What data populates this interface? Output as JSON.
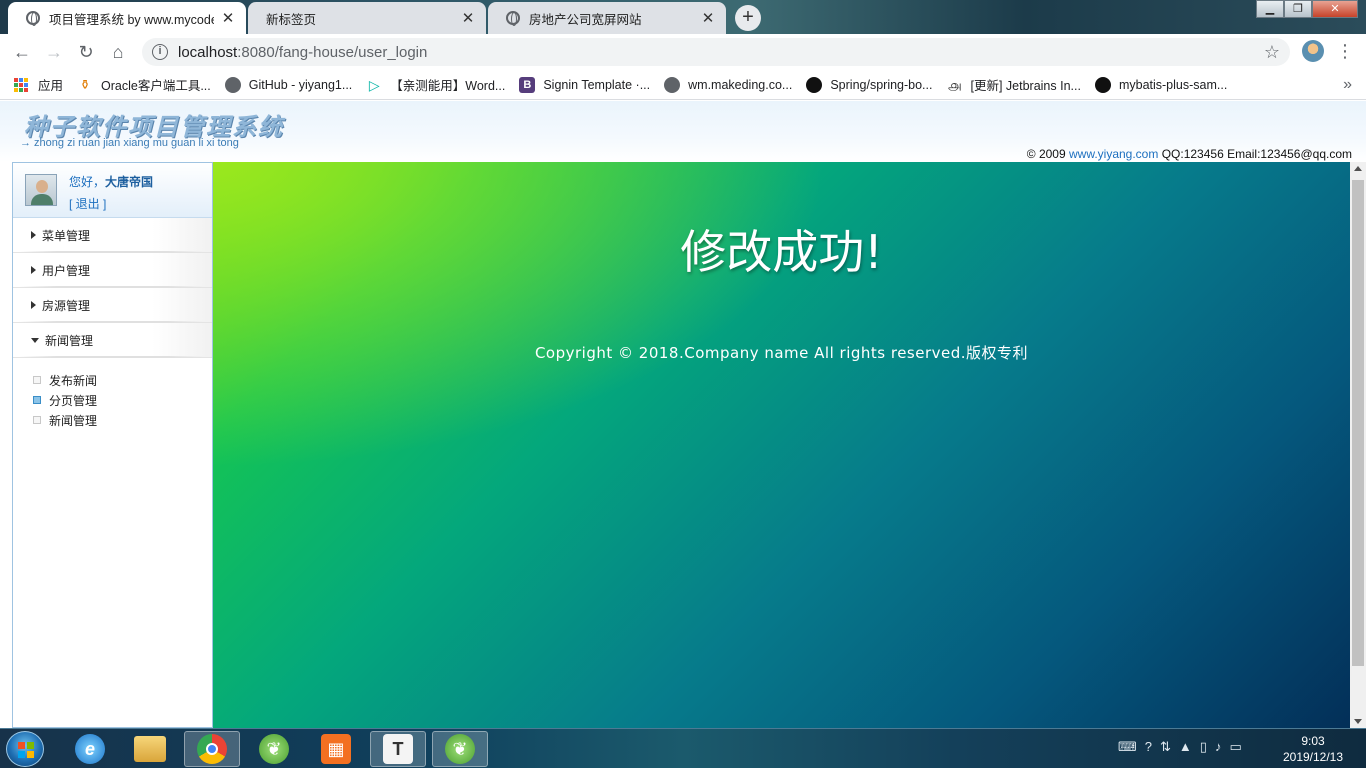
{
  "browser": {
    "tabs": [
      {
        "title": "项目管理系统 by www.mycodes",
        "active": true
      },
      {
        "title": "新标签页",
        "active": false
      },
      {
        "title": "房地产公司宽屏网站",
        "active": false
      }
    ],
    "new_tab": "+",
    "url_host": "localhost",
    "url_path": ":8080/fang-house/user_login",
    "bookmarks": [
      {
        "label": "应用",
        "icon": "apps-icon"
      },
      {
        "label": "Oracle客户端工具...",
        "icon": "oracle-icon"
      },
      {
        "label": "GitHub - yiyang1...",
        "icon": "globe-icon"
      },
      {
        "label": "【亲测能用】Word...",
        "icon": "play-icon"
      },
      {
        "label": "Signin Template ·...",
        "icon": "bootstrap-icon"
      },
      {
        "label": "wm.makeding.co...",
        "icon": "globe-icon"
      },
      {
        "label": "Spring/spring-bo...",
        "icon": "github-icon"
      },
      {
        "label": "[更新] Jetbrains In...",
        "icon": "spiral-icon"
      },
      {
        "label": "mybatis-plus-sam...",
        "icon": "github-icon"
      }
    ],
    "more": "»"
  },
  "header": {
    "title": "种子软件项目管理系统",
    "subtitle": "→ zhong zi ruan jian xiang mu guan li xi tong",
    "copyright_prefix": "© 2009",
    "site_link": "www.yiyang.com",
    "contact": "QQ:123456 Email:123456@qq.com"
  },
  "sidebar": {
    "greeting": "您好，",
    "username": "大唐帝国",
    "logout": "[ 退出 ]",
    "sections": [
      {
        "label": "菜单管理",
        "expanded": false
      },
      {
        "label": "用户管理",
        "expanded": false
      },
      {
        "label": "房源管理",
        "expanded": false
      },
      {
        "label": "新闻管理",
        "expanded": true
      }
    ],
    "subitems": [
      {
        "label": "发布新闻",
        "selected": false
      },
      {
        "label": "分页管理",
        "selected": true
      },
      {
        "label": "新闻管理",
        "selected": false
      }
    ]
  },
  "main": {
    "message": "修改成功!",
    "copyright": "Copyright © 2018.Company name All rights reserved.版权专利"
  },
  "taskbar": {
    "time": "9:03",
    "date": "2019/12/13"
  },
  "colors": {
    "link": "#1d6fbf",
    "gradient_start": "#9be81e",
    "gradient_end": "#032f58"
  }
}
